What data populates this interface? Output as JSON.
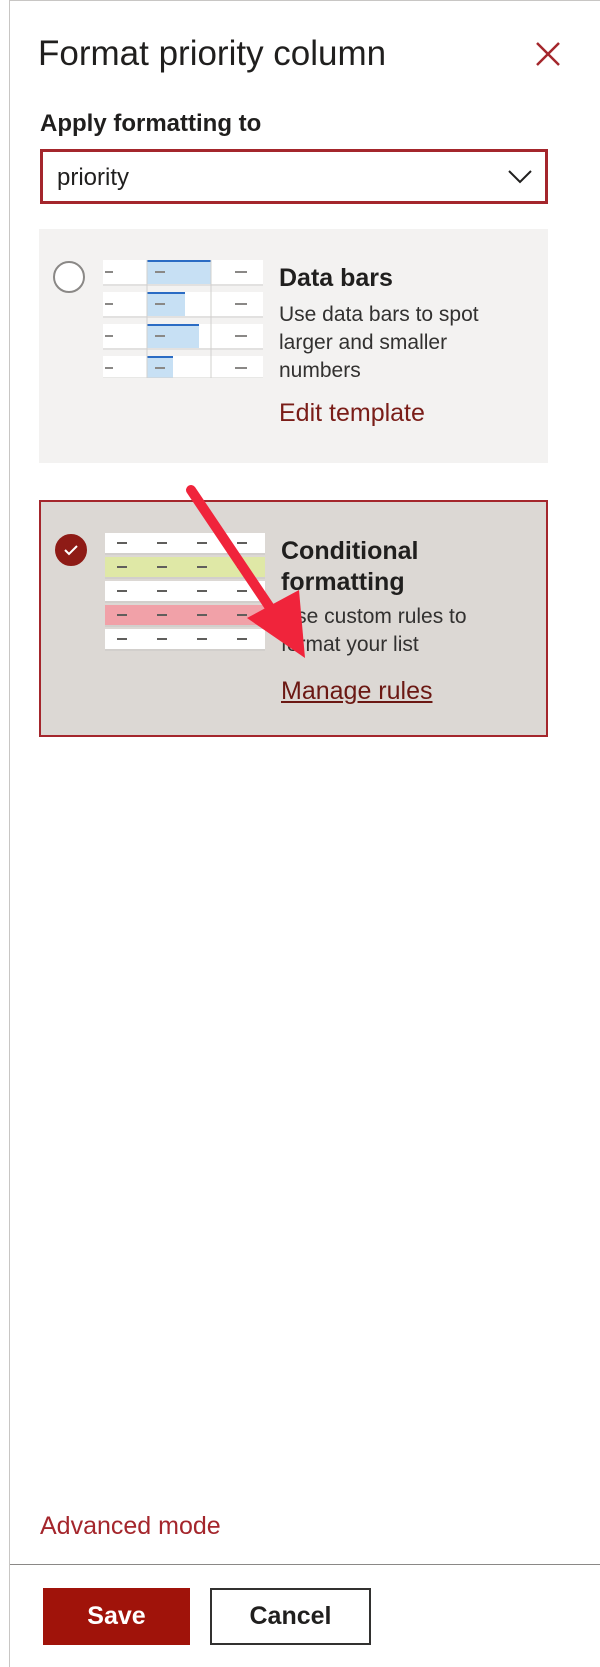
{
  "panel": {
    "title": "Format priority column",
    "close_icon": "close-icon"
  },
  "apply": {
    "label": "Apply formatting to",
    "selected": "priority",
    "chevron_icon": "chevron-down-icon"
  },
  "options": [
    {
      "title": "Data bars",
      "description": "Use data bars to spot larger and smaller numbers",
      "link": "Edit template",
      "selected": false
    },
    {
      "title": "Conditional formatting",
      "description": "Use custom rules to format your list",
      "link": "Manage rules",
      "selected": true
    }
  ],
  "footer": {
    "advanced": "Advanced mode",
    "save": "Save",
    "cancel": "Cancel"
  },
  "colors": {
    "accent": "#a4262c",
    "annotation_arrow": "#f0243b"
  }
}
